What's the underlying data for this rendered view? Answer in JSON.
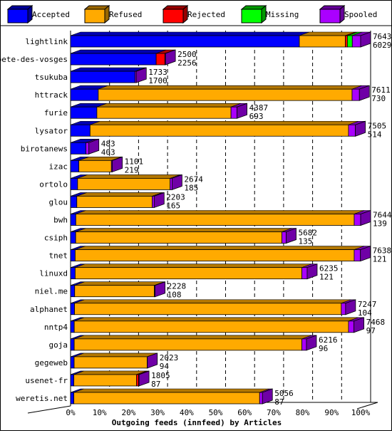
{
  "chart_data": {
    "type": "bar",
    "orientation": "horizontal",
    "stacked": true,
    "title": "Outgoing feeds (innfeed) by Articles",
    "xlabel": "Outgoing feeds (innfeed) by Articles",
    "x_ticks": [
      "0%",
      "10%",
      "20%",
      "30%",
      "40%",
      "50%",
      "60%",
      "70%",
      "80%",
      "90%",
      "100%"
    ],
    "xlim": [
      0,
      100
    ],
    "grid": true,
    "legend_placement": "top",
    "series": [
      {
        "name": "Accepted",
        "color": "#0000ff"
      },
      {
        "name": "Refused",
        "color": "#ffaa00"
      },
      {
        "name": "Rejected",
        "color": "#ff0000"
      },
      {
        "name": "Missing",
        "color": "#00ff00"
      },
      {
        "name": "Spooled",
        "color": "#aa00ff"
      }
    ],
    "rows": [
      {
        "host": "lightlink",
        "offered": 7643,
        "accepted": 6029,
        "values": [
          6029,
          1210,
          55,
          130,
          219
        ]
      },
      {
        "host": "bete-des-vosges",
        "offered": 2500,
        "accepted": 2256,
        "values": [
          2256,
          0,
          230,
          0,
          14
        ]
      },
      {
        "host": "tsukuba",
        "offered": 1733,
        "accepted": 1700,
        "values": [
          1700,
          0,
          0,
          0,
          33
        ]
      },
      {
        "host": "httrack",
        "offered": 7611,
        "accepted": 730,
        "values": [
          730,
          6688,
          0,
          0,
          193
        ]
      },
      {
        "host": "furie",
        "offered": 4387,
        "accepted": 693,
        "values": [
          693,
          3535,
          0,
          0,
          159
        ]
      },
      {
        "host": "lysator",
        "offered": 7505,
        "accepted": 514,
        "values": [
          514,
          6809,
          0,
          0,
          182
        ]
      },
      {
        "host": "birotanews",
        "offered": 483,
        "accepted": 403,
        "values": [
          403,
          0,
          0,
          0,
          80
        ]
      },
      {
        "host": "izac",
        "offered": 1101,
        "accepted": 219,
        "values": [
          219,
          857,
          0,
          0,
          25
        ]
      },
      {
        "host": "ortolo",
        "offered": 2674,
        "accepted": 185,
        "values": [
          185,
          2438,
          0,
          0,
          51
        ]
      },
      {
        "host": "glou",
        "offered": 2203,
        "accepted": 165,
        "values": [
          165,
          1987,
          0,
          0,
          51
        ]
      },
      {
        "host": "bwh",
        "offered": 7644,
        "accepted": 139,
        "values": [
          139,
          7335,
          0,
          0,
          170
        ]
      },
      {
        "host": "csiph",
        "offered": 5682,
        "accepted": 135,
        "values": [
          135,
          5433,
          0,
          0,
          114
        ]
      },
      {
        "host": "tnet",
        "offered": 7638,
        "accepted": 121,
        "values": [
          121,
          7353,
          0,
          0,
          164
        ]
      },
      {
        "host": "linuxd",
        "offered": 6235,
        "accepted": 121,
        "values": [
          121,
          5975,
          0,
          0,
          139
        ]
      },
      {
        "host": "niel.me",
        "offered": 2228,
        "accepted": 108,
        "values": [
          108,
          2100,
          0,
          0,
          20
        ]
      },
      {
        "host": "alphanet",
        "offered": 7247,
        "accepted": 104,
        "values": [
          104,
          7030,
          0,
          0,
          113
        ]
      },
      {
        "host": "nntp4",
        "offered": 7468,
        "accepted": 97,
        "values": [
          97,
          7226,
          0,
          0,
          145
        ]
      },
      {
        "host": "goja",
        "offered": 6216,
        "accepted": 96,
        "values": [
          96,
          6000,
          0,
          0,
          120
        ]
      },
      {
        "host": "gegeweb",
        "offered": 2023,
        "accepted": 94,
        "values": [
          94,
          1925,
          0,
          0,
          4
        ]
      },
      {
        "host": "usenet-fr",
        "offered": 1805,
        "accepted": 87,
        "values": [
          87,
          1649,
          57,
          0,
          12
        ]
      },
      {
        "host": "weretis.net",
        "offered": 5056,
        "accepted": 87,
        "values": [
          87,
          4895,
          0,
          0,
          74
        ]
      }
    ]
  }
}
